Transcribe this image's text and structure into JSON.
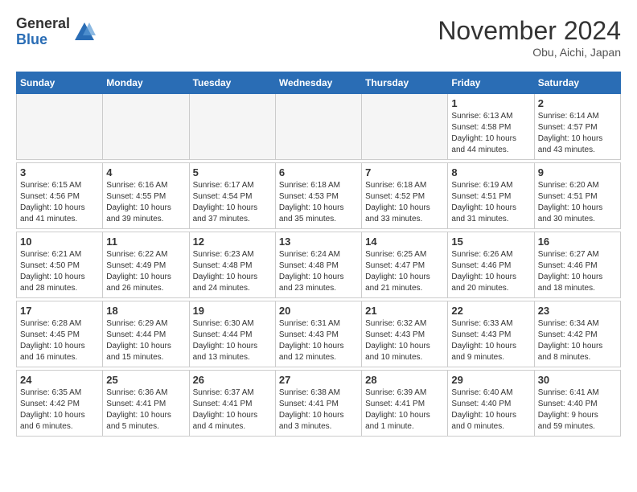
{
  "logo": {
    "general": "General",
    "blue": "Blue"
  },
  "header": {
    "month": "November 2024",
    "location": "Obu, Aichi, Japan"
  },
  "weekdays": [
    "Sunday",
    "Monday",
    "Tuesday",
    "Wednesday",
    "Thursday",
    "Friday",
    "Saturday"
  ],
  "weeks": [
    [
      {
        "day": "",
        "info": ""
      },
      {
        "day": "",
        "info": ""
      },
      {
        "day": "",
        "info": ""
      },
      {
        "day": "",
        "info": ""
      },
      {
        "day": "",
        "info": ""
      },
      {
        "day": "1",
        "info": "Sunrise: 6:13 AM\nSunset: 4:58 PM\nDaylight: 10 hours\nand 44 minutes."
      },
      {
        "day": "2",
        "info": "Sunrise: 6:14 AM\nSunset: 4:57 PM\nDaylight: 10 hours\nand 43 minutes."
      }
    ],
    [
      {
        "day": "3",
        "info": "Sunrise: 6:15 AM\nSunset: 4:56 PM\nDaylight: 10 hours\nand 41 minutes."
      },
      {
        "day": "4",
        "info": "Sunrise: 6:16 AM\nSunset: 4:55 PM\nDaylight: 10 hours\nand 39 minutes."
      },
      {
        "day": "5",
        "info": "Sunrise: 6:17 AM\nSunset: 4:54 PM\nDaylight: 10 hours\nand 37 minutes."
      },
      {
        "day": "6",
        "info": "Sunrise: 6:18 AM\nSunset: 4:53 PM\nDaylight: 10 hours\nand 35 minutes."
      },
      {
        "day": "7",
        "info": "Sunrise: 6:18 AM\nSunset: 4:52 PM\nDaylight: 10 hours\nand 33 minutes."
      },
      {
        "day": "8",
        "info": "Sunrise: 6:19 AM\nSunset: 4:51 PM\nDaylight: 10 hours\nand 31 minutes."
      },
      {
        "day": "9",
        "info": "Sunrise: 6:20 AM\nSunset: 4:51 PM\nDaylight: 10 hours\nand 30 minutes."
      }
    ],
    [
      {
        "day": "10",
        "info": "Sunrise: 6:21 AM\nSunset: 4:50 PM\nDaylight: 10 hours\nand 28 minutes."
      },
      {
        "day": "11",
        "info": "Sunrise: 6:22 AM\nSunset: 4:49 PM\nDaylight: 10 hours\nand 26 minutes."
      },
      {
        "day": "12",
        "info": "Sunrise: 6:23 AM\nSunset: 4:48 PM\nDaylight: 10 hours\nand 24 minutes."
      },
      {
        "day": "13",
        "info": "Sunrise: 6:24 AM\nSunset: 4:48 PM\nDaylight: 10 hours\nand 23 minutes."
      },
      {
        "day": "14",
        "info": "Sunrise: 6:25 AM\nSunset: 4:47 PM\nDaylight: 10 hours\nand 21 minutes."
      },
      {
        "day": "15",
        "info": "Sunrise: 6:26 AM\nSunset: 4:46 PM\nDaylight: 10 hours\nand 20 minutes."
      },
      {
        "day": "16",
        "info": "Sunrise: 6:27 AM\nSunset: 4:46 PM\nDaylight: 10 hours\nand 18 minutes."
      }
    ],
    [
      {
        "day": "17",
        "info": "Sunrise: 6:28 AM\nSunset: 4:45 PM\nDaylight: 10 hours\nand 16 minutes."
      },
      {
        "day": "18",
        "info": "Sunrise: 6:29 AM\nSunset: 4:44 PM\nDaylight: 10 hours\nand 15 minutes."
      },
      {
        "day": "19",
        "info": "Sunrise: 6:30 AM\nSunset: 4:44 PM\nDaylight: 10 hours\nand 13 minutes."
      },
      {
        "day": "20",
        "info": "Sunrise: 6:31 AM\nSunset: 4:43 PM\nDaylight: 10 hours\nand 12 minutes."
      },
      {
        "day": "21",
        "info": "Sunrise: 6:32 AM\nSunset: 4:43 PM\nDaylight: 10 hours\nand 10 minutes."
      },
      {
        "day": "22",
        "info": "Sunrise: 6:33 AM\nSunset: 4:43 PM\nDaylight: 10 hours\nand 9 minutes."
      },
      {
        "day": "23",
        "info": "Sunrise: 6:34 AM\nSunset: 4:42 PM\nDaylight: 10 hours\nand 8 minutes."
      }
    ],
    [
      {
        "day": "24",
        "info": "Sunrise: 6:35 AM\nSunset: 4:42 PM\nDaylight: 10 hours\nand 6 minutes."
      },
      {
        "day": "25",
        "info": "Sunrise: 6:36 AM\nSunset: 4:41 PM\nDaylight: 10 hours\nand 5 minutes."
      },
      {
        "day": "26",
        "info": "Sunrise: 6:37 AM\nSunset: 4:41 PM\nDaylight: 10 hours\nand 4 minutes."
      },
      {
        "day": "27",
        "info": "Sunrise: 6:38 AM\nSunset: 4:41 PM\nDaylight: 10 hours\nand 3 minutes."
      },
      {
        "day": "28",
        "info": "Sunrise: 6:39 AM\nSunset: 4:41 PM\nDaylight: 10 hours\nand 1 minute."
      },
      {
        "day": "29",
        "info": "Sunrise: 6:40 AM\nSunset: 4:40 PM\nDaylight: 10 hours\nand 0 minutes."
      },
      {
        "day": "30",
        "info": "Sunrise: 6:41 AM\nSunset: 4:40 PM\nDaylight: 9 hours\nand 59 minutes."
      }
    ]
  ]
}
